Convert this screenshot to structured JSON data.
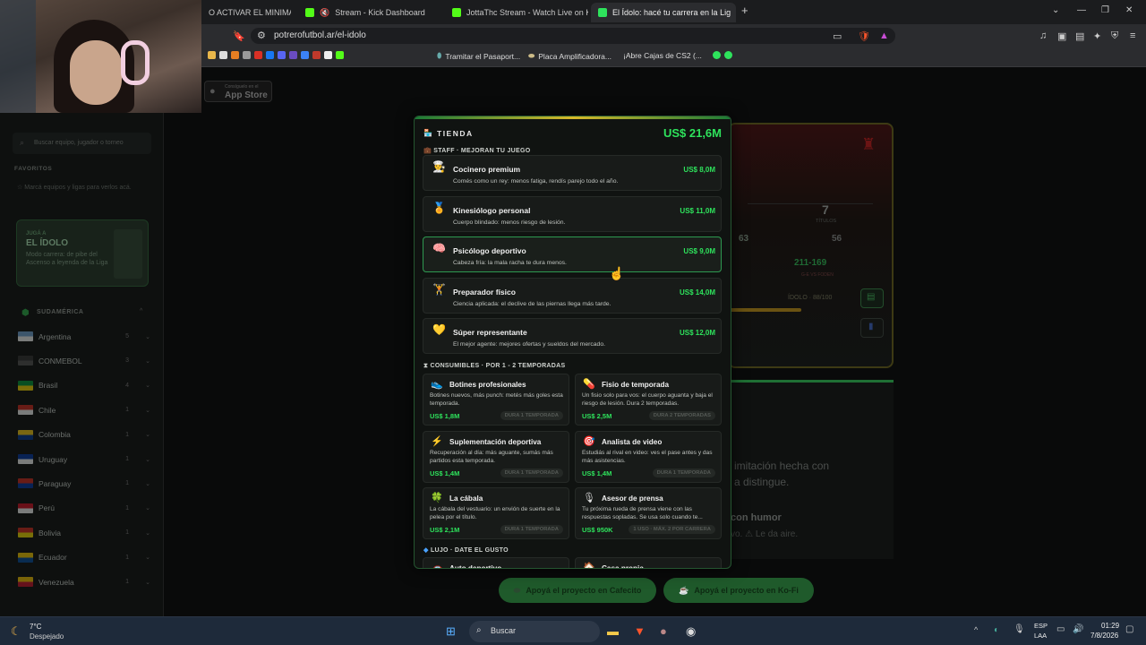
{
  "browser": {
    "tabs": [
      {
        "title": "O ACTIVAR EL MINIMAPA",
        "color": "#666666"
      },
      {
        "title": "Stream - Kick Dashboard",
        "color": "#53fc18"
      },
      {
        "title": "JottaThc Stream - Watch Live on Kick",
        "color": "#53fc18"
      },
      {
        "title": "El Ídolo: hacé tu carrera en la Lig",
        "color": "#2ee35c"
      }
    ],
    "url": "potrerofutbol.ar/el-idolo",
    "bookmarks": [
      "Tramitar el Pasaport...",
      "Placa Amplificadora...",
      "¡Abre Cajas de CS2 (..."
    ]
  },
  "background_page": {
    "appstore_top": "Consíguelo en el",
    "appstore_name": "App Store",
    "search_placeholder": "Buscar equipo, jugador o torneo",
    "favoritos_title": "FAVORITOS",
    "favoritos_hint": "Marcá equipos y ligas para verlos acá.",
    "promo": {
      "kicker": "JUGÁ A",
      "title": "EL ÍDOLO",
      "desc": "Modo carrera: de pibe del Ascenso a leyenda de la Liga"
    },
    "region": "SUDAMÉRICA",
    "countries": [
      {
        "name": "Argentina",
        "count": "5",
        "colors": [
          "#75aadb",
          "#ffffff"
        ]
      },
      {
        "name": "CONMEBOL",
        "count": "3",
        "colors": [
          "#333333",
          "#555555"
        ]
      },
      {
        "name": "Brasil",
        "count": "4",
        "colors": [
          "#009b3a",
          "#fedf00"
        ]
      },
      {
        "name": "Chile",
        "count": "1",
        "colors": [
          "#d52b1e",
          "#ffffff"
        ]
      },
      {
        "name": "Colombia",
        "count": "1",
        "colors": [
          "#fcd116",
          "#003893"
        ]
      },
      {
        "name": "Uruguay",
        "count": "1",
        "colors": [
          "#0038a8",
          "#ffffff"
        ]
      },
      {
        "name": "Paraguay",
        "count": "1",
        "colors": [
          "#d52b1e",
          "#0038a8"
        ]
      },
      {
        "name": "Perú",
        "count": "1",
        "colors": [
          "#d91023",
          "#ffffff"
        ]
      },
      {
        "name": "Bolivia",
        "count": "1",
        "colors": [
          "#d52b1e",
          "#f9e300"
        ]
      },
      {
        "name": "Ecuador",
        "count": "1",
        "colors": [
          "#ffd100",
          "#034ea2"
        ]
      },
      {
        "name": "Venezuela",
        "count": "1",
        "colors": [
          "#ffcc00",
          "#cf142b"
        ]
      }
    ],
    "card": {
      "titles_value": "7",
      "titles_label": "TÍTULOS",
      "stat1": "63",
      "stat2": "56",
      "record": "211-169",
      "record_label": "G-E VS FODEN",
      "idolo": "ÍDOLO · 88/100"
    },
    "text_line1": "imitación hecha con",
    "text_line2": "a distingue.",
    "text_line3": "con humor",
    "text_line4": "vo. ⚠ Le da aire.",
    "buttons": [
      "Apoyá el proyecto en Cafecito",
      "Apoyá el proyecto en Ko-Fi"
    ]
  },
  "shop": {
    "title": "TIENDA",
    "balance": "US$ 21,6M",
    "staff_header": "STAFF · MEJORAN TU JUEGO",
    "staff": [
      {
        "icon": "👨‍🍳",
        "name": "Cocinero premium",
        "desc": "Comés como un rey: menos fatiga, rendís parejo todo el año.",
        "price": "US$ 8,0M"
      },
      {
        "icon": "🏅",
        "name": "Kinesiólogo personal",
        "desc": "Cuerpo blindado: menos riesgo de lesión.",
        "price": "US$ 11,0M"
      },
      {
        "icon": "🧠",
        "name": "Psicólogo deportivo",
        "desc": "Cabeza fría: la mala racha te dura menos.",
        "price": "US$ 9,0M"
      },
      {
        "icon": "🏋",
        "name": "Preparador físico",
        "desc": "Ciencia aplicada: el declive de las piernas llega más tarde.",
        "price": "US$ 14,0M"
      },
      {
        "icon": "💛",
        "name": "Súper representante",
        "desc": "El mejor agente: mejores ofertas y sueldos del mercado.",
        "price": "US$ 12,0M"
      }
    ],
    "consumibles_header": "CONSUMIBLES · POR 1 - 2 TEMPORADAS",
    "consumibles": [
      {
        "icon": "👟",
        "name": "Botines profesionales",
        "desc": "Botines nuevos, más punch: metés más goles esta temporada.",
        "price": "US$ 1,8M",
        "tag": "DURA 1 TEMPORADA"
      },
      {
        "icon": "💊",
        "name": "Fisio de temporada",
        "desc": "Un fisio solo para vos: el cuerpo aguanta y baja el riesgo de lesión. Dura 2 temporadas.",
        "price": "US$ 2,5M",
        "tag": "DURA 2 TEMPORADAS"
      },
      {
        "icon": "⚡",
        "name": "Suplementación deportiva",
        "desc": "Recuperación al día: más aguante, sumás más partidos esta temporada.",
        "price": "US$ 1,4M",
        "tag": "DURA 1 TEMPORADA"
      },
      {
        "icon": "🎯",
        "name": "Analista de video",
        "desc": "Estudiás al rival en video: ves el pase antes y das más asistencias.",
        "price": "US$ 1,4M",
        "tag": "DURA 1 TEMPORADA"
      },
      {
        "icon": "🍀",
        "name": "La cábala",
        "desc": "La cábala del vestuario: un envión de suerte en la pelea por el título.",
        "price": "US$ 2,1M",
        "tag": "DURA 1 TEMPORADA"
      },
      {
        "icon": "🎙",
        "name": "Asesor de prensa",
        "desc": "Tu próxima rueda de prensa viene con las respuestas sopladas. Se usa solo cuando te...",
        "price": "US$ 950K",
        "tag": "1 USO · MÁX. 2 POR CARRERA"
      }
    ],
    "lujo_header": "LUJO · DATE EL GUSTO",
    "lujo": [
      {
        "icon": "🚗",
        "name": "Auto deportivo"
      },
      {
        "icon": "🏠",
        "name": "Casa propia"
      }
    ]
  },
  "taskbar": {
    "weather_temp": "7°C",
    "weather_desc": "Despejado",
    "search": "Buscar",
    "lang1": "ESP",
    "lang2": "LAA",
    "time": "01:29",
    "date": "7/8/2026"
  }
}
